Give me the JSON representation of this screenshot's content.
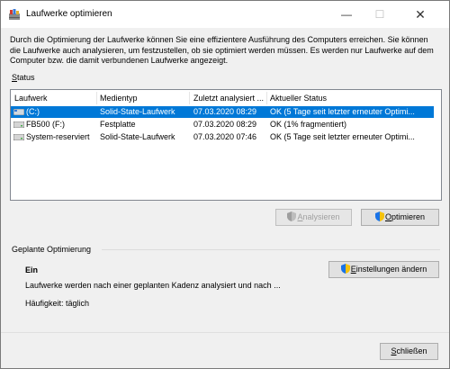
{
  "window": {
    "title": "Laufwerke optimieren"
  },
  "description": "Durch die Optimierung der Laufwerke können Sie eine effizientere Ausführung des Computers erreichen. Sie können die Laufwerke auch analysieren, um festzustellen, ob sie optimiert werden müssen. Es werden nur Laufwerke auf dem Computer bzw. die damit verbundenen Laufwerke angezeigt.",
  "status_label": "Status",
  "table": {
    "headers": [
      "Laufwerk",
      "Medientyp",
      "Zuletzt analysiert ...",
      "Aktueller Status"
    ],
    "rows": [
      {
        "drive": "(C:)",
        "media": "Solid-State-Laufwerk",
        "last": "07.03.2020 08:29",
        "status": "OK (5 Tage seit letzter erneuter Optimi...",
        "selected": true
      },
      {
        "drive": "FB500 (F:)",
        "media": "Festplatte",
        "last": "07.03.2020 08:29",
        "status": "OK (1% fragmentiert)",
        "selected": false
      },
      {
        "drive": "System-reserviert",
        "media": "Solid-State-Laufwerk",
        "last": "07.03.2020 07:46",
        "status": "OK (5 Tage seit letzter erneuter Optimi...",
        "selected": false
      }
    ]
  },
  "buttons": {
    "analyze": {
      "mnemonic": "A",
      "rest": "nalysieren",
      "disabled": true
    },
    "optimize": {
      "mnemonic": "O",
      "rest": "ptimieren"
    },
    "change_settings": {
      "mnemonic": "E",
      "rest": "instellungen ändern"
    },
    "close": {
      "mnemonic": "S",
      "rest": "chließen"
    }
  },
  "scheduled": {
    "label": "Geplante Optimierung",
    "state": "Ein",
    "description": "Laufwerke werden nach einer geplanten Kadenz analysiert und nach ...",
    "frequency": "Häufigkeit: täglich"
  },
  "colors": {
    "selection": "#0078d7",
    "window_bg": "#f0f0f0",
    "button_bg": "#e1e1e1"
  },
  "icons": [
    "app-defrag-icon",
    "minimize-icon",
    "maximize-icon",
    "close-icon",
    "drive-icon",
    "uac-shield-icon"
  ]
}
